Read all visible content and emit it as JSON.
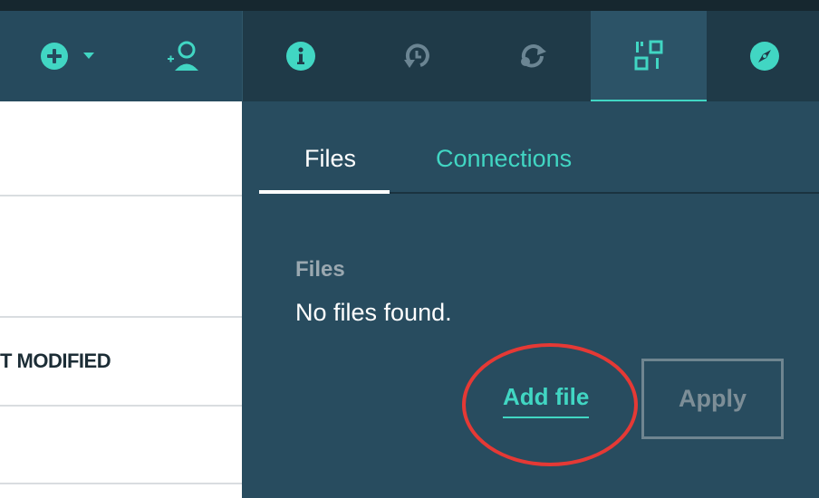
{
  "colors": {
    "accent": "#41d6c3",
    "toolbar_left": "#264a5d",
    "toolbar_right": "#1f3a48",
    "panel": "#284c5f",
    "annotation": "#e53935"
  },
  "left_toolbar": {
    "icons": [
      "add-circle-icon",
      "chevron-down-icon",
      "add-user-icon"
    ]
  },
  "right_toolbar": {
    "icons": [
      "info-icon",
      "history-icon",
      "sync-icon",
      "data-icon",
      "compass-icon"
    ],
    "active_index": 3
  },
  "main": {
    "column_header": "T MODIFIED"
  },
  "panel": {
    "tabs": [
      {
        "label": "Files",
        "active": true
      },
      {
        "label": "Connections",
        "active": false
      }
    ],
    "section_title": "Files",
    "empty_message": "No files found.",
    "add_file_label": "Add file",
    "apply_label": "Apply"
  }
}
